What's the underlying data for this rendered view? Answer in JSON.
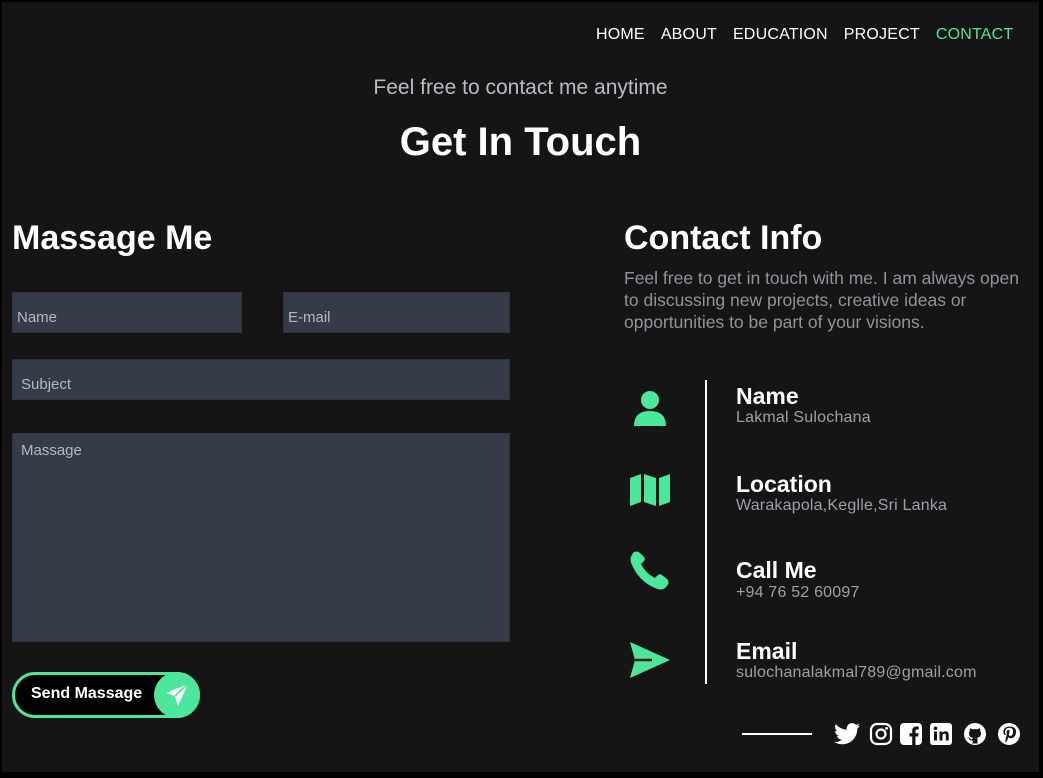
{
  "nav": {
    "items": [
      {
        "label": "HOME"
      },
      {
        "label": "ABOUT"
      },
      {
        "label": "EDUCATION"
      },
      {
        "label": "PROJECT"
      },
      {
        "label": "CONTACT"
      }
    ],
    "active": "CONTACT",
    "active_color": "#4ce79a"
  },
  "header": {
    "subtitle": "Feel free to contact me anytime",
    "title": "Get In Touch"
  },
  "form": {
    "heading": "Massage Me",
    "name_placeholder": "Name",
    "email_placeholder": "E-mail",
    "subject_placeholder": "Subject",
    "message_placeholder": "Massage",
    "send_label": "Send Massage",
    "send_icon": "paper-plane-icon"
  },
  "contact": {
    "heading": "Contact Info",
    "description": "Feel free to get in touch with me. I am always open to discussing new projects, creative ideas or opportunities to be part of your visions.",
    "items": [
      {
        "icon": "user-icon",
        "title": "Name",
        "value": "Lakmal Sulochana"
      },
      {
        "icon": "map-icon",
        "title": "Location",
        "value": "Warakapola,Keglle,Sri Lanka"
      },
      {
        "icon": "phone-icon",
        "title": "Call Me",
        "value": "+94 76 52 60097"
      },
      {
        "icon": "send-icon",
        "title": "Email",
        "value": "sulochanalakmal789@gmail.com"
      }
    ]
  },
  "social": [
    "twitter-icon",
    "instagram-icon",
    "facebook-icon",
    "linkedin-icon",
    "github-icon",
    "pinterest-icon"
  ],
  "colors": {
    "accent": "#4ce79a",
    "background": "#151515",
    "field": "#363b4a"
  }
}
